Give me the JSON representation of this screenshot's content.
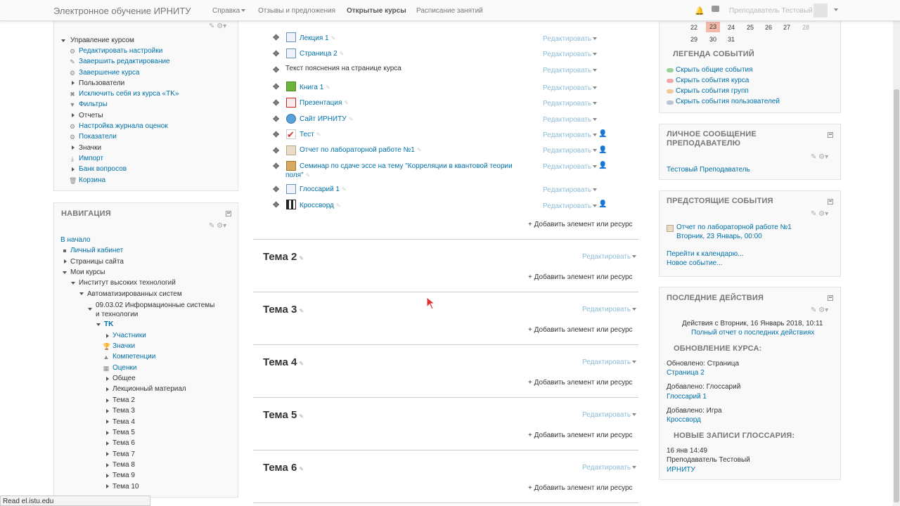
{
  "header": {
    "brand": "Электронное обучение ИРНИТУ",
    "menu": [
      "Справка",
      "Отзывы и предложения",
      "Открытые курсы",
      "Расписание занятий"
    ],
    "user": "Преподаватель Тестовый"
  },
  "admin": {
    "title": "Управление курсом",
    "items": [
      "Редактировать настройки",
      "Завершить редактирование",
      "Завершение курса",
      "Пользователи",
      "Исключить себя из курса «TK»",
      "Фильтры",
      "Отчеты",
      "Настройка журнала оценок",
      "Показатели",
      "Значки",
      "Импорт",
      "Банк вопросов",
      "Корзина"
    ]
  },
  "nav": {
    "title": "НАВИГАЦИЯ",
    "home": "В начало",
    "dashboard": "Личный кабинет",
    "site_pages": "Страницы сайта",
    "my_courses": "Мои курсы",
    "institute": "Институт высоких технологий",
    "dept": "Автоматизированных систем",
    "program": "09.03.02 Информационные системы и технологии",
    "course": "TK",
    "course_items": [
      "Участники",
      "Значки",
      "Компетенции",
      "Оценки",
      "Общее",
      "Лекционный материал",
      "Тема 2",
      "Тема 3",
      "Тема 4",
      "Тема 5",
      "Тема 6",
      "Тема 7",
      "Тема 8",
      "Тема 9",
      "Тема 10"
    ]
  },
  "activities": [
    {
      "name": "Лекция 1",
      "icon": "lesson-icon",
      "edit": "Редактировать"
    },
    {
      "name": "Страница 2",
      "icon": "page-icon",
      "edit": "Редактировать"
    },
    {
      "name": "Текст пояснения на странице курса",
      "icon": "label",
      "edit": "Редактировать"
    },
    {
      "name": "Книга 1",
      "icon": "book-icon",
      "edit": "Редактировать"
    },
    {
      "name": "Презентация",
      "icon": "pdf-icon",
      "edit": "Редактировать"
    },
    {
      "name": "Сайт ИРНИТУ",
      "icon": "url-icon",
      "edit": "Редактировать"
    },
    {
      "name": "Тест",
      "icon": "quiz-icon",
      "edit": "Редактировать"
    },
    {
      "name": "Отчет по лабораторной работе №1",
      "icon": "assignment-icon",
      "edit": "Редактировать"
    },
    {
      "name": "Семинар по сдаче эссе на тему \"Корреляции в квантовой теории",
      "name2": "поля\"",
      "icon": "workshop-icon",
      "edit": "Редактировать"
    },
    {
      "name": "Глоссарий 1",
      "icon": "glossary-icon",
      "edit": "Редактировать"
    },
    {
      "name": "Кроссворд",
      "icon": "crossword-icon",
      "edit": "Редактировать"
    }
  ],
  "add_label": "Добавить элемент или ресурс",
  "sections": [
    {
      "title": "Тема 2",
      "edit": "Редактировать"
    },
    {
      "title": "Тема 3",
      "edit": "Редактировать"
    },
    {
      "title": "Тема 4",
      "edit": "Редактировать"
    },
    {
      "title": "Тема 5",
      "edit": "Редактировать"
    },
    {
      "title": "Тема 6",
      "edit": "Редактировать"
    }
  ],
  "calendar": {
    "row1": [
      "22",
      "23",
      "24",
      "25",
      "26",
      "27",
      "28"
    ],
    "row2": [
      "29",
      "30",
      "31"
    ],
    "legend_title": "ЛЕГЕНДА СОБЫТИЙ",
    "legend": [
      "Скрыть общие события",
      "Скрыть события курса",
      "Скрыть события групп",
      "Скрыть события пользователей"
    ],
    "legend_colors": [
      "#9ad39a",
      "#f0a8a8",
      "#f2c89a",
      "#b8c4d8"
    ]
  },
  "message": {
    "title": "ЛИЧНОЕ СООБЩЕНИЕ ПРЕПОДАВАТЕЛЮ",
    "link": "Тестовый Преподаватель"
  },
  "upcoming": {
    "title": "ПРЕДСТОЯЩИЕ СОБЫТИЯ",
    "event": "Отчет по лабораторной работе №1",
    "date": "Вторник, 23 Январь, 00:00",
    "calendar_link": "Перейти к календарю...",
    "new_event": "Новое событие..."
  },
  "recent": {
    "title": "ПОСЛЕДНИЕ ДЕЙСТВИЯ",
    "since": "Действия с Вторник, 16 Январь 2018, 10:11",
    "full_report": "Полный отчет о последних действиях",
    "updates_title": "ОБНОВЛЕНИЕ КУРСА:",
    "u1": "Обновлено: Страница",
    "u1_link": "Страница 2",
    "u2": "Добавлено: Глоссарий",
    "u2_link": "Глоссарий 1",
    "u3": "Добавлено: Игра",
    "u3_link": "Кроссворд",
    "glossary_title": "НОВЫЕ ЗАПИСИ ГЛОССАРИЯ:",
    "g_date": "16 янв 14:49",
    "g_author": "Преподаватель Тестовый",
    "g_link": "ИРНИТУ"
  },
  "status": "Read el.istu.edu"
}
